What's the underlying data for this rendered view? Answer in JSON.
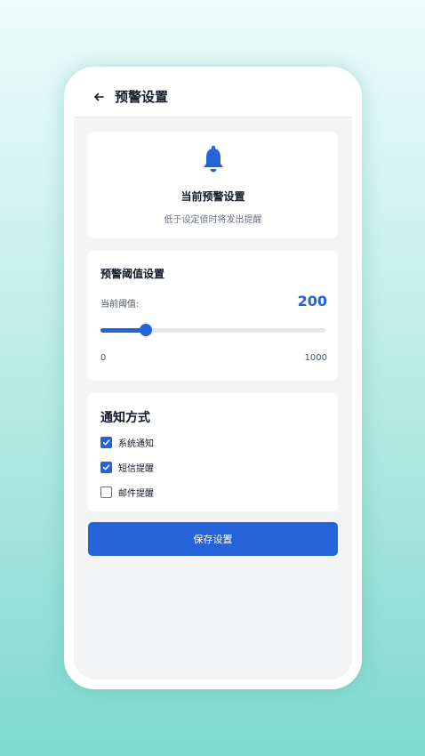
{
  "header": {
    "title": "预警设置",
    "back_icon": "arrow-left-icon"
  },
  "hero": {
    "icon": "bell-icon",
    "title": "当前预警设置",
    "subtitle": "低于设定值时将发出提醒"
  },
  "threshold": {
    "title": "预警阈值设置",
    "current_label": "当前阈值:",
    "current_value": 200,
    "min": 0,
    "max": 1000,
    "min_label": "0",
    "max_label": "1000"
  },
  "notify": {
    "title": "通知方式",
    "options": [
      {
        "label": "系统通知",
        "checked": true
      },
      {
        "label": "短信提醒",
        "checked": true
      },
      {
        "label": "邮件提醒",
        "checked": false
      }
    ]
  },
  "save_label": "保存设置",
  "colors": {
    "accent": "#2563d9",
    "background_top": "#eefcfb",
    "background_bottom": "#7fd9cf"
  }
}
